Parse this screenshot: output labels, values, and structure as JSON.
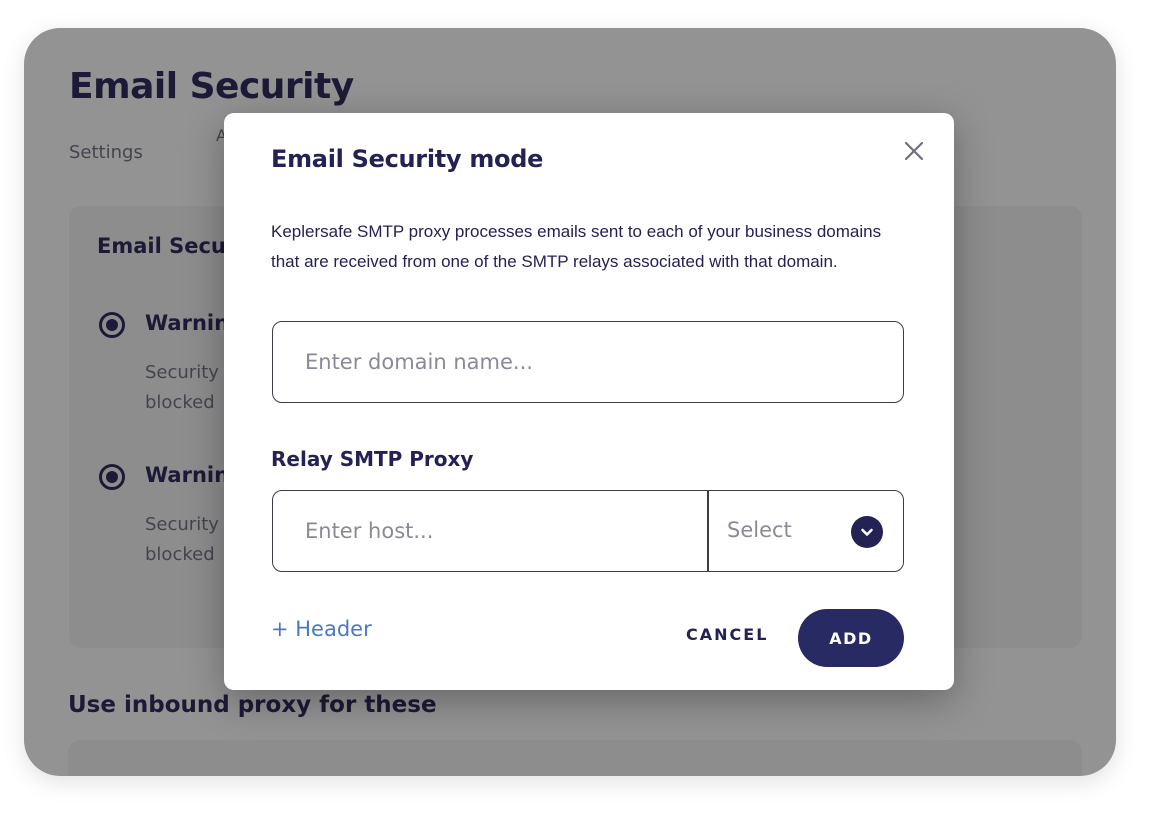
{
  "page": {
    "title": "Email Security",
    "breadcrumb": "Settings",
    "breadcrumb_extra": "A"
  },
  "mode_card": {
    "title": "Email Security mode",
    "options": [
      {
        "label": "Warning",
        "desc_line1": "Security",
        "desc_line2": "blocked"
      },
      {
        "label": "Warning",
        "desc_line1": "Security",
        "desc_line2": "blocked"
      }
    ]
  },
  "inbound": {
    "title": "Use inbound proxy for these"
  },
  "modal": {
    "title": "Email Security mode",
    "close_icon": "close-icon",
    "description": "Keplersafe SMTP proxy processes emails sent to each of your business domains that are received from one of the SMTP relays associated with that domain.",
    "domain_placeholder": "Enter domain name...",
    "domain_value": "",
    "relay_label": "Relay SMTP Proxy",
    "host_placeholder": "Enter host...",
    "host_value": "",
    "select_placeholder": "Select",
    "select_icon": "chevron-down-icon",
    "header_link": "+ Header",
    "cancel_label": "CANCEL",
    "add_label": "ADD"
  },
  "colors": {
    "primary": "#242154",
    "button": "#272a63",
    "link": "#4a78c8",
    "muted": "#6e6e80",
    "card_bg": "#f4f4f6",
    "overlay": "rgba(20,20,20,0.46)"
  }
}
